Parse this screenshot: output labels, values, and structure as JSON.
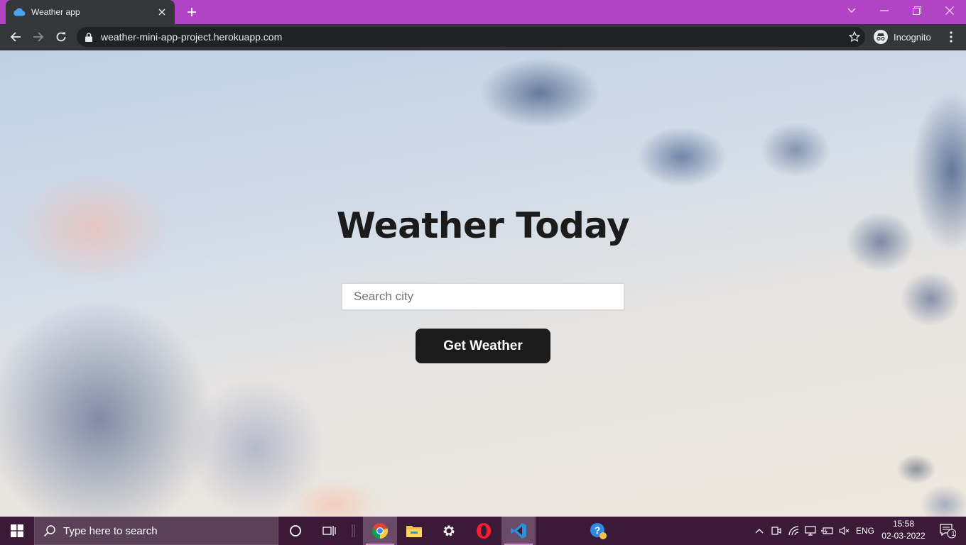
{
  "browser": {
    "tab_title": "Weather app",
    "url": "weather-mini-app-project.herokuapp.com",
    "profile_label": "Incognito",
    "titlebar_color": "#b044c4"
  },
  "page": {
    "title": "Weather Today",
    "search_placeholder": "Search city",
    "search_value": "",
    "button_label": "Get Weather"
  },
  "taskbar": {
    "search_placeholder": "Type here to search",
    "pinned_apps": [
      "cortana-icon",
      "task-view-icon",
      "chrome-icon",
      "file-explorer-icon",
      "settings-icon",
      "opera-icon",
      "vscode-icon",
      "help-icon"
    ],
    "language": "ENG",
    "time": "15:58",
    "date": "02-03-2022",
    "notification_count": "1"
  }
}
